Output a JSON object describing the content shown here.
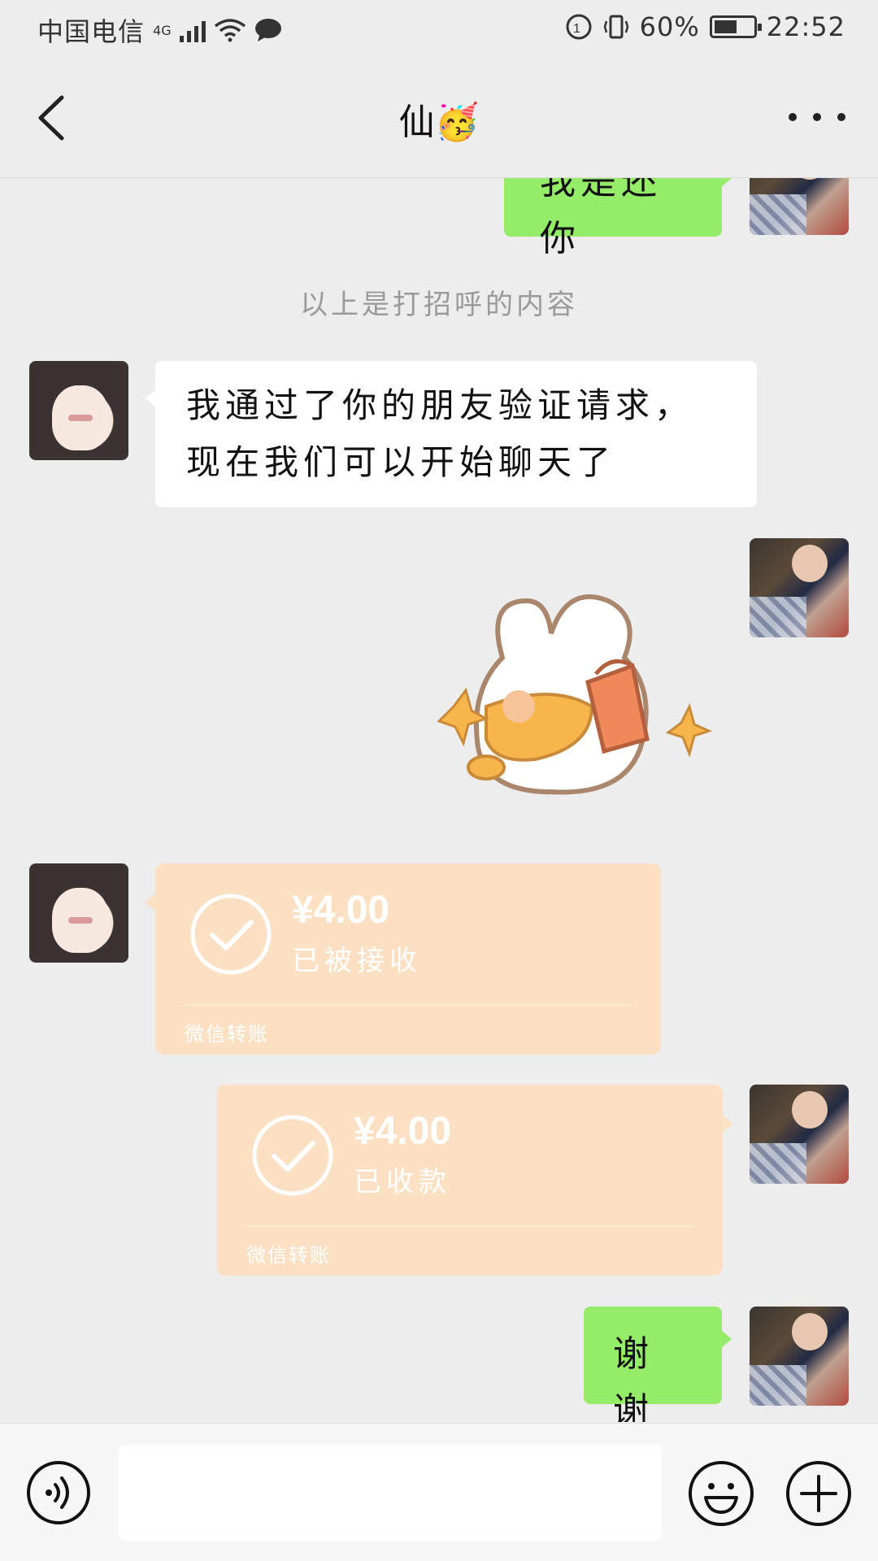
{
  "status_bar": {
    "carrier": "中国电信",
    "network": "4G",
    "battery_text": "60%",
    "battery_level": 0.6,
    "time": "22:52"
  },
  "header": {
    "title": "仙🥳"
  },
  "messages": {
    "m1_text": "我是还你",
    "system_note": "以上是打招呼的内容",
    "m2_text": "我通过了你的朋友验证请求，现在我们可以开始聊天了",
    "transfer_in": {
      "amount": "¥4.00",
      "status": "已被接收",
      "footer": "微信转账"
    },
    "transfer_out": {
      "amount": "¥4.00",
      "status": "已收款",
      "footer": "微信转账"
    },
    "m_last_text": "谢谢"
  },
  "input": {
    "placeholder": ""
  },
  "colors": {
    "bubble_green": "#95ec69",
    "transfer_bg": "#fbe0c3",
    "background": "#ededed"
  },
  "icons": {
    "back": "back-arrow-icon",
    "more": "more-dots-icon",
    "voice": "voice-icon",
    "emoji": "emoji-icon",
    "plus": "plus-icon",
    "check": "check-circle-icon"
  }
}
